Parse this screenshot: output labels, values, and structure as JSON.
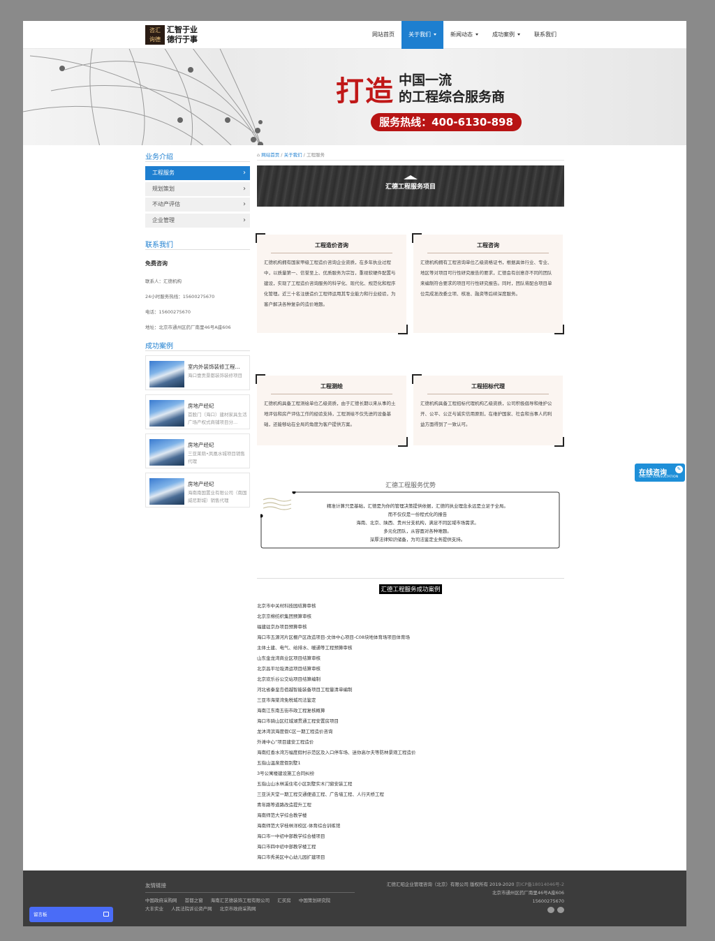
{
  "header": {
    "logo_seal": [
      "咨汇",
      "询德"
    ],
    "logo_lines": [
      "汇智于业",
      "德行于事"
    ],
    "nav": [
      {
        "label": "网站首页",
        "has_caret": false,
        "active": false
      },
      {
        "label": "关于我们",
        "has_caret": true,
        "active": true
      },
      {
        "label": "新闻动态",
        "has_caret": true,
        "active": false
      },
      {
        "label": "成功案例",
        "has_caret": true,
        "active": false
      },
      {
        "label": "联系我们",
        "has_caret": false,
        "active": false
      }
    ]
  },
  "banner": {
    "big": "打造",
    "line1": "中国一流",
    "line2": "的工程综合服务商",
    "hotline": "服务热线：400-6130-898"
  },
  "sidebar": {
    "business_title": "业务介绍",
    "menu": [
      {
        "label": "工程服务",
        "active": true
      },
      {
        "label": "规划策划",
        "active": false
      },
      {
        "label": "不动产评估",
        "active": false
      },
      {
        "label": "企业管理",
        "active": false
      }
    ],
    "contact_title": "联系我们",
    "contact_sub": "免费咨询",
    "contact_lines": [
      "联系人：汇德机构",
      "24小时服务热线：15600275670",
      "电话：15600275670",
      "地址：北京市通州区药厂南里46号A座606"
    ],
    "cases_title": "成功案例",
    "cases": [
      {
        "title": "室内外装饰装修工程...",
        "desc": "海口壹贡景都装饰装修项目"
      },
      {
        "title": "房地产经纪",
        "desc": "首股门（海口）建材家具生活广场产权式商铺项目分..."
      },
      {
        "title": "房地产经纪",
        "desc": "三亚莱荫•凤凰水城项目销售代理"
      },
      {
        "title": "房地产经纪",
        "desc": "海南南国置业有限公司（南国威尼斯城）销售代理"
      }
    ]
  },
  "breadcrumb": {
    "home": "网站首页",
    "sep": "/",
    "parent": "关于我们",
    "current": "工程服务"
  },
  "main": {
    "banner_title": "汇德工程服务项目",
    "services": [
      {
        "title": "工程造价咨询",
        "text": "汇德机构拥有国家甲级工程造价咨询企业资质，在多年执业过程中，以质量第一、信誉至上、优质服务为宗旨，重视软硬件配置与建设，实现了工程造价咨询服务的科学化、现代化、规范化和程序化管理。近三十名注册造价工程师运用其专业能力和行业经验，为客户解决各种复杂的造价难题。"
      },
      {
        "title": "工程咨询",
        "text": "汇德机构拥有工程咨询单位乙级资格证书，根据具体行业、专业、地区等对项目可行性研究报告的要求，汇德会有创意亦不同的团队来编制符合要求的项目可行性研究报告。同时，团队将配合项目单位完成发改委立项、核准、融资等后续深度服务。"
      },
      {
        "title": "工程测绘",
        "text": "汇德机构具备工程测绘单位乙级资质，由于汇德长期以来从事的土地评估和房产评估工作的经验支持，工程测绘不仅先进的设备基础，还能够站在全局的角度为客户提供方案。"
      },
      {
        "title": "工程招标代理",
        "text": "汇德机构具备工程招标代理机构乙级资质，公司积极倡导和维护公开、公平、公正与诚实信用原则，在维护国家、社会和当事人的利益方面得到了一致认可。"
      }
    ],
    "advantages_title": "汇德工程服务优势",
    "advantages": [
      "精准计算只是基础，汇德是为你的管理决策提供依据，汇德的执业理念永远是立足于全局。",
      "而不仅仅是一份程式化的报告",
      "海南、北京、陕西、贵州分支机构，满足不同区域市场需求。",
      "多元化团队，从容面对各种难题。",
      "深厚法律知识储备，为司法鉴定业务提供支持。"
    ],
    "cases_heading": "汇德工程服务成功案例",
    "case_list": [
      "北京市中关村科技园结算审核",
      "北京京棉纺织集团预算审核",
      "福建驻京办项目预算审核",
      "海口市五源河片区棚户区改造项目-文体中心项目-C08块地体育场项目体育场",
      "主体土建、电气、给排水、暖通等工程预算审核",
      "山东金龙湾商业区项目结算审核",
      "北京昌平垃圾清运项目结算审核",
      "北京欢乐谷公交站项目结算编制",
      "河北省秦皇岛佰越智能装备项目工程量清单编制",
      "三亚市海棠湾免税城司法鉴定",
      "海南江东南五街市政工程复核概算",
      "海口市骑山区红城湖贯通工程安置房项目",
      "龙沐湾滨海度假C区一期工程造价咨询",
      "外滩中心”项目建安工程造价",
      "海南红香水湾万福度假村示范区及入口停车场、迷你高尔夫等防林景观工程造价",
      "五指山温泉度假别墅1",
      "3号公寓楼建设施工合同纠纷",
      "五指山山水林溪住宅小区别墅实木门窗安装工程",
      "三亚沃天堂一期工程交通便道工程、广告墙工程、人行天桥工程",
      "青年路等道路改造提升工程",
      "海南师范大学综合教学楼",
      "海南师范大学桂林洋校区-体育综合训练馆",
      "海口市一中初中部教学综合楼项目",
      "海口市四中初中部教学楼工程",
      "海口市秀英区中心幼儿园扩建项目"
    ]
  },
  "float": {
    "online_cn": "在线咨询",
    "online_en": "ONLINE CONSULTATION"
  },
  "footer": {
    "links_title": "友情链接",
    "links": [
      "中国政府采购网",
      "首都之窗",
      "海南汇艺德装饰工程有限公司",
      "汇买房",
      "中国策划研究院",
      "大丰实业",
      "人民法院诉讼资产网",
      "北京市政府采购网"
    ],
    "copyright": "汇德汇昭企业管理咨询（北京）有限公司 版权所有 2019-2020",
    "icp": "京ICP备18014046号-2",
    "address": "北京市通州区药厂南里46号A座606",
    "phone": "15600275670"
  },
  "message_bar": {
    "label": "留言板"
  },
  "colors": {
    "accent": "#1e7fd0",
    "banner_red": "#c01818",
    "footer_bg": "#3c3c3c"
  }
}
